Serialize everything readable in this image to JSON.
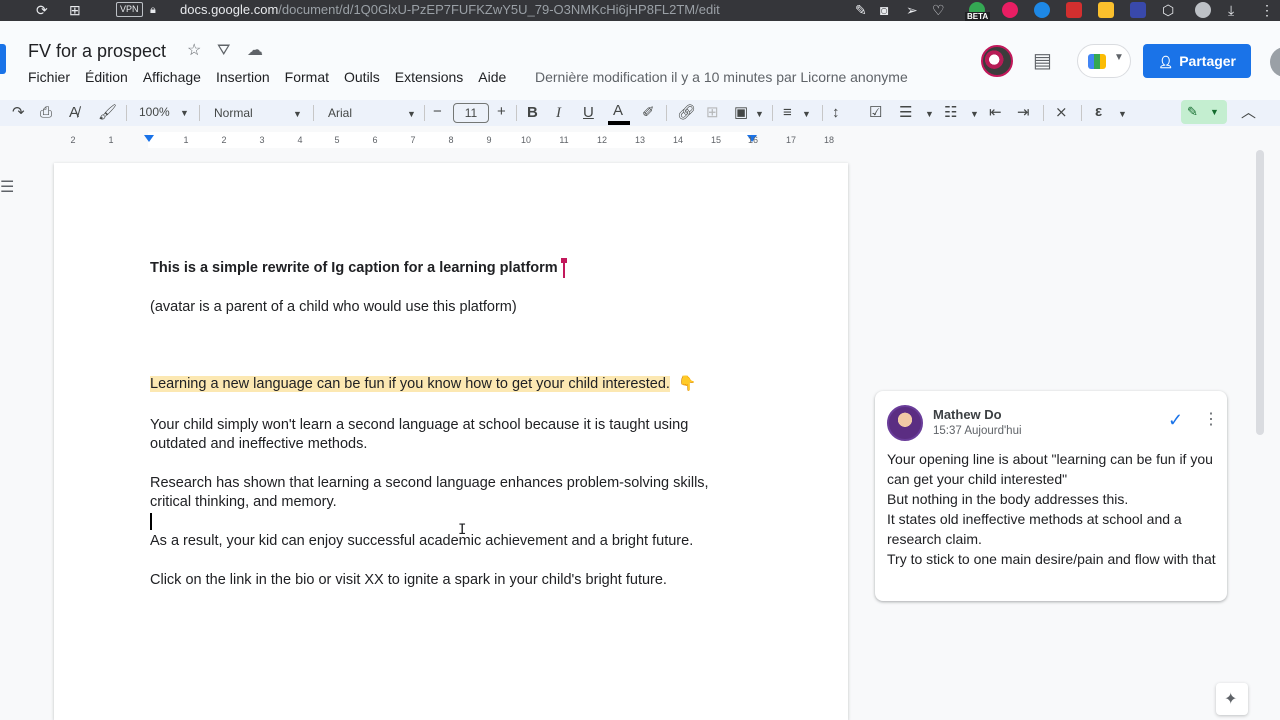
{
  "browser": {
    "vpn_label": "VPN",
    "url_host": "docs.google.com",
    "url_path": "/document/d/1Q0GlxU-PzEP7FUFKZwY5U_79-O3NMKcHi6jHP8FL2TM/edit",
    "beta_label": "BETA",
    "icons": [
      "reload-icon",
      "apps-icon",
      "lock-icon",
      "pencil-icon",
      "camera-icon",
      "send-icon",
      "heart-icon",
      "download-icon"
    ]
  },
  "doc": {
    "title": "FV for a prospect",
    "menu": [
      "Fichier",
      "Édition",
      "Affichage",
      "Insertion",
      "Format",
      "Outils",
      "Extensions",
      "Aide"
    ],
    "last_edit": "Dernière modification il y a 10 minutes par Licorne anonyme",
    "share_label": "Partager"
  },
  "toolbar": {
    "zoom": "100%",
    "style": "Normal",
    "font": "Arial",
    "font_size": "11"
  },
  "ruler": {
    "numbers": [
      "2",
      "1",
      "1",
      "2",
      "3",
      "4",
      "5",
      "6",
      "7",
      "8",
      "9",
      "10",
      "11",
      "12",
      "13",
      "14",
      "15",
      "16",
      "17",
      "18"
    ]
  },
  "content": {
    "heading": "This is a simple rewrite of Ig caption for a learning platform",
    "avatar_note": "(avatar is a parent of a child who would use this platform)",
    "hook": "Learning a new language can be fun if you know how to get your child interested.",
    "hook_emoji": "👇",
    "p1_l1": "Your child simply won't learn a second language at school because it is taught using",
    "p1_l2": "outdated and ineffective methods.",
    "p2_l1": "Research has shown that learning a second language enhances problem-solving skills,",
    "p2_l2": "critical thinking, and memory.",
    "p3": "As a result, your kid can enjoy successful academic achievement and a bright future.",
    "p4": "Click on the link in the bio or visit XX to ignite a spark in your child's bright future."
  },
  "comment": {
    "author": "Mathew Do",
    "time": "15:37 Aujourd'hui",
    "lines": [
      "Your opening line is about \"learning can be fun if you can get your child interested\"",
      "But nothing in the body addresses this.",
      "It states old ineffective methods at school and a research claim.",
      "Try to stick to one main desire/pain and flow with that"
    ]
  },
  "colors": {
    "accent": "#1a73e8",
    "highlight": "#fce8b2",
    "cursor_pink": "#c2185b",
    "edit_mode_bg": "#c4eed0"
  }
}
